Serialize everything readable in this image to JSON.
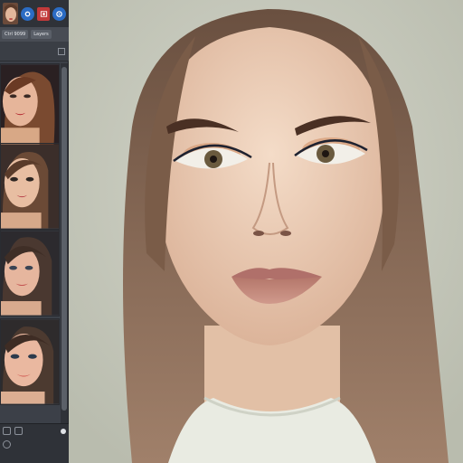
{
  "toolbar": {
    "items": [
      "avatar-thumbnail",
      "settings-icon",
      "photo-icon",
      "help-icon"
    ]
  },
  "tabs": [
    {
      "label": "Ctrl 9099"
    },
    {
      "label": "Layers"
    }
  ],
  "panel": {
    "thumbnails": [
      {
        "label": "face-variant-1"
      },
      {
        "label": "face-variant-2"
      },
      {
        "label": "face-variant-3"
      },
      {
        "label": "face-variant-4"
      }
    ]
  },
  "colors": {
    "panel_bg": "#3c4048",
    "toolbar_bg": "#2f3238",
    "canvas_bg": "#c9cbbf",
    "accent_blue": "#2b6cc4",
    "accent_red": "#c23a3a"
  },
  "canvas": {
    "subject": "portrait"
  }
}
